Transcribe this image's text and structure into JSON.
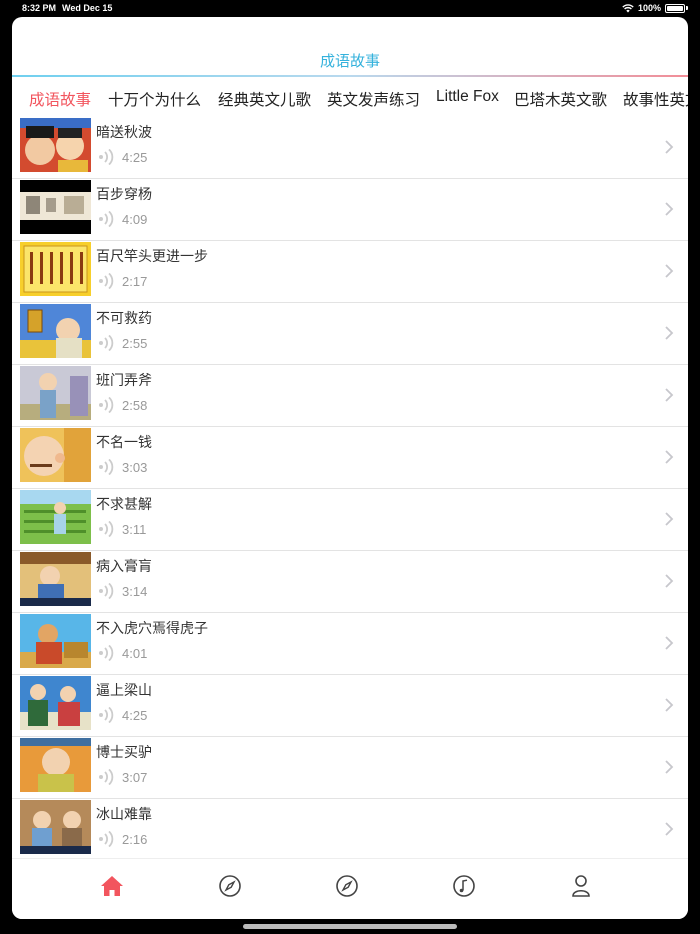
{
  "status": {
    "time": "8:32 PM",
    "date": "Wed Dec 15",
    "battery": "100%"
  },
  "header": {
    "title": "成语故事"
  },
  "tabs": [
    {
      "label": "成语故事",
      "active": true
    },
    {
      "label": "十万个为什么",
      "active": false
    },
    {
      "label": "经典英文儿歌",
      "active": false
    },
    {
      "label": "英文发声练习",
      "active": false
    },
    {
      "label": "Little Fox",
      "active": false
    },
    {
      "label": "巴塔木英文歌",
      "active": false
    },
    {
      "label": "故事性英文",
      "active": false
    }
  ],
  "items": [
    {
      "title": "暗送秋波",
      "duration": "4:25"
    },
    {
      "title": "百步穿杨",
      "duration": "4:09"
    },
    {
      "title": "百尺竿头更进一步",
      "duration": "2:17"
    },
    {
      "title": "不可救药",
      "duration": "2:55"
    },
    {
      "title": "班门弄斧",
      "duration": "2:58"
    },
    {
      "title": "不名一钱",
      "duration": "3:03"
    },
    {
      "title": "不求甚解",
      "duration": "3:11"
    },
    {
      "title": "病入膏肓",
      "duration": "3:14"
    },
    {
      "title": "不入虎穴焉得虎子",
      "duration": "4:01"
    },
    {
      "title": "逼上梁山",
      "duration": "4:25"
    },
    {
      "title": "博士买驴",
      "duration": "3:07"
    },
    {
      "title": "冰山难靠",
      "duration": "2:16"
    }
  ],
  "tabbar": [
    {
      "icon": "home-icon",
      "active": true
    },
    {
      "icon": "compass-icon",
      "active": false
    },
    {
      "icon": "compass-icon",
      "active": false
    },
    {
      "icon": "music-note-icon",
      "active": false
    },
    {
      "icon": "person-icon",
      "active": false
    }
  ],
  "colors": {
    "accent": "#f2555e",
    "title": "#35b2dc"
  }
}
